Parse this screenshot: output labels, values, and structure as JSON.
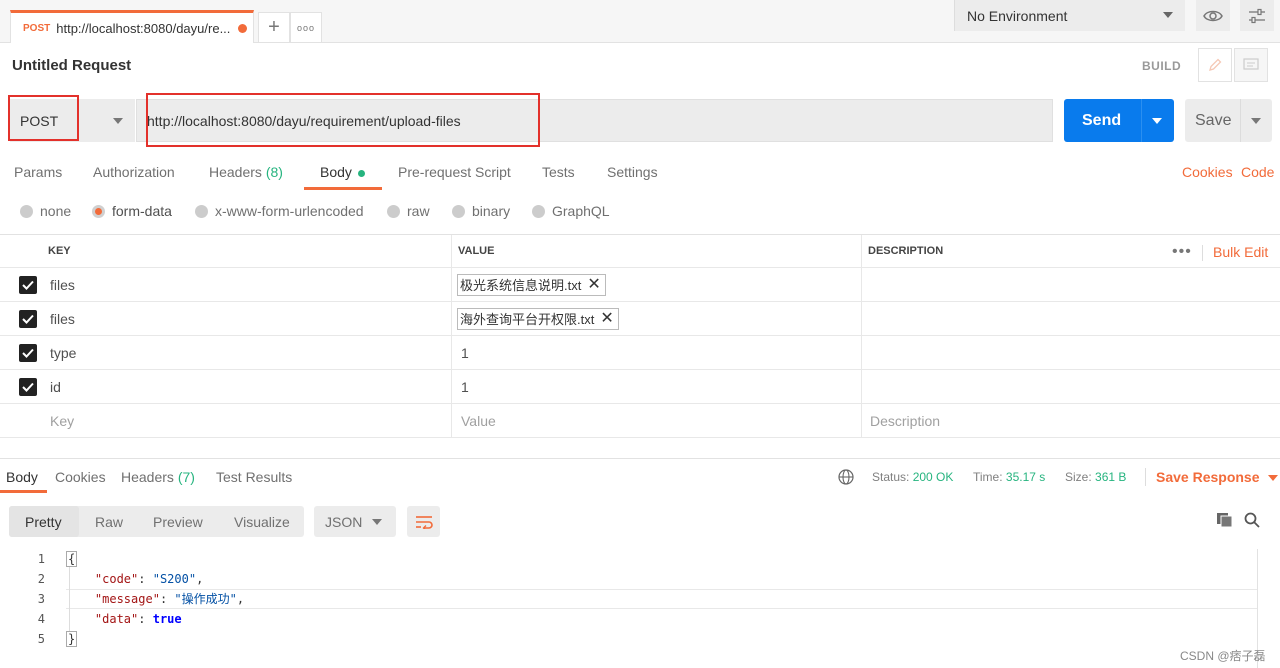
{
  "tabs": {
    "active": {
      "method": "POST",
      "url": "http://localhost:8080/dayu/re..."
    },
    "add_label": "+",
    "more_label": "ooo"
  },
  "environment": {
    "selected": "No Environment"
  },
  "request": {
    "title": "Untitled Request",
    "build_label": "BUILD",
    "method": "POST",
    "url": "http://localhost:8080/dayu/requirement/upload-files",
    "send_label": "Send",
    "save_label": "Save"
  },
  "request_tabs": {
    "params": "Params",
    "authorization": "Authorization",
    "headers": "Headers",
    "headers_count": "(8)",
    "body": "Body",
    "prerequest": "Pre-request Script",
    "tests": "Tests",
    "settings": "Settings",
    "cookies": "Cookies",
    "code": "Code"
  },
  "body_types": {
    "none": "none",
    "form_data": "form-data",
    "urlencoded": "x-www-form-urlencoded",
    "raw": "raw",
    "binary": "binary",
    "graphql": "GraphQL"
  },
  "form_table": {
    "headers": {
      "key": "KEY",
      "value": "VALUE",
      "description": "DESCRIPTION",
      "bulk_edit": "Bulk Edit"
    },
    "rows": [
      {
        "key": "files",
        "file": "极光系统信息说明.txt"
      },
      {
        "key": "files",
        "file": "海外查询平台开权限.txt"
      },
      {
        "key": "type",
        "value": "1"
      },
      {
        "key": "id",
        "value": "1"
      }
    ],
    "placeholders": {
      "key": "Key",
      "value": "Value",
      "description": "Description"
    }
  },
  "response": {
    "tabs": {
      "body": "Body",
      "cookies": "Cookies",
      "headers": "Headers",
      "headers_count": "(7)",
      "tests": "Test Results"
    },
    "status_label": "Status:",
    "status_value": "200 OK",
    "time_label": "Time:",
    "time_value": "35.17 s",
    "size_label": "Size:",
    "size_value": "361 B",
    "save_response": "Save Response",
    "views": {
      "pretty": "Pretty",
      "raw": "Raw",
      "preview": "Preview",
      "visualize": "Visualize"
    },
    "format": "JSON",
    "lines": [
      "1",
      "2",
      "3",
      "4",
      "5"
    ],
    "json": {
      "open": "{",
      "code_key": "\"code\"",
      "code_val": "\"S200\"",
      "message_key": "\"message\"",
      "message_val": "\"操作成功\"",
      "data_key": "\"data\"",
      "data_val": "true",
      "close": "}"
    }
  },
  "watermark": "CSDN @痞子磊",
  "colors": {
    "accent": "#f26b3a",
    "send": "#097bed",
    "success": "#26b47f",
    "highlight": "#e3312b"
  }
}
